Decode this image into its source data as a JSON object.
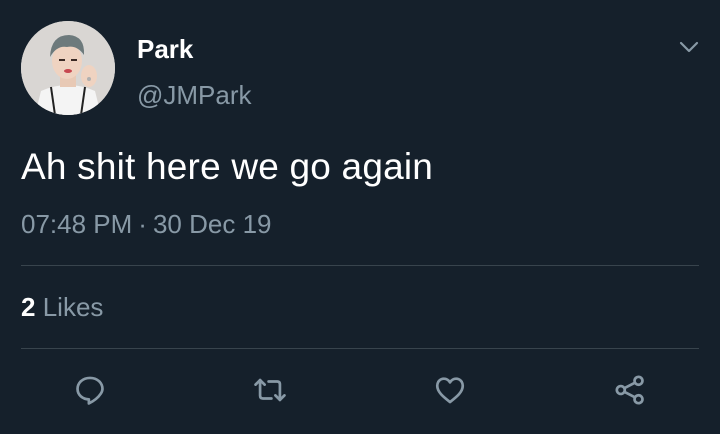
{
  "user": {
    "display_name": "Park",
    "handle": "@JMPark"
  },
  "tweet": {
    "text": "Ah shit here we go again",
    "time": "07:48 PM",
    "separator": "·",
    "date": "30 Dec 19"
  },
  "stats": {
    "likes_count": "2",
    "likes_label": "Likes"
  },
  "actions": [
    {
      "icon": "reply-icon"
    },
    {
      "icon": "retweet-icon"
    },
    {
      "icon": "like-icon"
    },
    {
      "icon": "share-icon"
    }
  ],
  "colors": {
    "background": "#15202b",
    "primary_text": "#ffffff",
    "secondary_text": "#8899a6",
    "divider": "#38444d"
  }
}
